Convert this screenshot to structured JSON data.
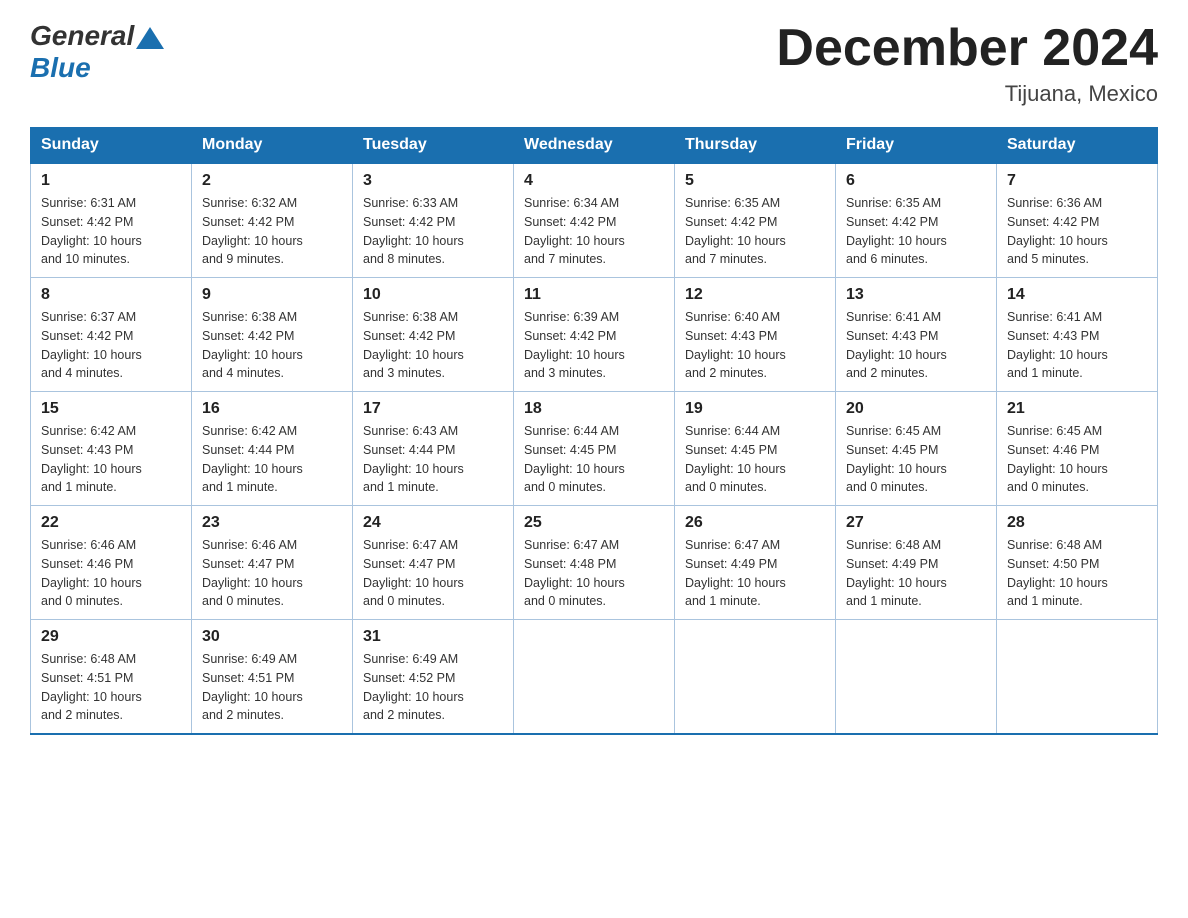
{
  "logo": {
    "general": "General",
    "blue": "Blue"
  },
  "title": "December 2024",
  "location": "Tijuana, Mexico",
  "days_header": [
    "Sunday",
    "Monday",
    "Tuesday",
    "Wednesday",
    "Thursday",
    "Friday",
    "Saturday"
  ],
  "weeks": [
    [
      {
        "day": "1",
        "sunrise": "6:31 AM",
        "sunset": "4:42 PM",
        "daylight": "10 hours and 10 minutes."
      },
      {
        "day": "2",
        "sunrise": "6:32 AM",
        "sunset": "4:42 PM",
        "daylight": "10 hours and 9 minutes."
      },
      {
        "day": "3",
        "sunrise": "6:33 AM",
        "sunset": "4:42 PM",
        "daylight": "10 hours and 8 minutes."
      },
      {
        "day": "4",
        "sunrise": "6:34 AM",
        "sunset": "4:42 PM",
        "daylight": "10 hours and 7 minutes."
      },
      {
        "day": "5",
        "sunrise": "6:35 AM",
        "sunset": "4:42 PM",
        "daylight": "10 hours and 7 minutes."
      },
      {
        "day": "6",
        "sunrise": "6:35 AM",
        "sunset": "4:42 PM",
        "daylight": "10 hours and 6 minutes."
      },
      {
        "day": "7",
        "sunrise": "6:36 AM",
        "sunset": "4:42 PM",
        "daylight": "10 hours and 5 minutes."
      }
    ],
    [
      {
        "day": "8",
        "sunrise": "6:37 AM",
        "sunset": "4:42 PM",
        "daylight": "10 hours and 4 minutes."
      },
      {
        "day": "9",
        "sunrise": "6:38 AM",
        "sunset": "4:42 PM",
        "daylight": "10 hours and 4 minutes."
      },
      {
        "day": "10",
        "sunrise": "6:38 AM",
        "sunset": "4:42 PM",
        "daylight": "10 hours and 3 minutes."
      },
      {
        "day": "11",
        "sunrise": "6:39 AM",
        "sunset": "4:42 PM",
        "daylight": "10 hours and 3 minutes."
      },
      {
        "day": "12",
        "sunrise": "6:40 AM",
        "sunset": "4:43 PM",
        "daylight": "10 hours and 2 minutes."
      },
      {
        "day": "13",
        "sunrise": "6:41 AM",
        "sunset": "4:43 PM",
        "daylight": "10 hours and 2 minutes."
      },
      {
        "day": "14",
        "sunrise": "6:41 AM",
        "sunset": "4:43 PM",
        "daylight": "10 hours and 1 minute."
      }
    ],
    [
      {
        "day": "15",
        "sunrise": "6:42 AM",
        "sunset": "4:43 PM",
        "daylight": "10 hours and 1 minute."
      },
      {
        "day": "16",
        "sunrise": "6:42 AM",
        "sunset": "4:44 PM",
        "daylight": "10 hours and 1 minute."
      },
      {
        "day": "17",
        "sunrise": "6:43 AM",
        "sunset": "4:44 PM",
        "daylight": "10 hours and 1 minute."
      },
      {
        "day": "18",
        "sunrise": "6:44 AM",
        "sunset": "4:45 PM",
        "daylight": "10 hours and 0 minutes."
      },
      {
        "day": "19",
        "sunrise": "6:44 AM",
        "sunset": "4:45 PM",
        "daylight": "10 hours and 0 minutes."
      },
      {
        "day": "20",
        "sunrise": "6:45 AM",
        "sunset": "4:45 PM",
        "daylight": "10 hours and 0 minutes."
      },
      {
        "day": "21",
        "sunrise": "6:45 AM",
        "sunset": "4:46 PM",
        "daylight": "10 hours and 0 minutes."
      }
    ],
    [
      {
        "day": "22",
        "sunrise": "6:46 AM",
        "sunset": "4:46 PM",
        "daylight": "10 hours and 0 minutes."
      },
      {
        "day": "23",
        "sunrise": "6:46 AM",
        "sunset": "4:47 PM",
        "daylight": "10 hours and 0 minutes."
      },
      {
        "day": "24",
        "sunrise": "6:47 AM",
        "sunset": "4:47 PM",
        "daylight": "10 hours and 0 minutes."
      },
      {
        "day": "25",
        "sunrise": "6:47 AM",
        "sunset": "4:48 PM",
        "daylight": "10 hours and 0 minutes."
      },
      {
        "day": "26",
        "sunrise": "6:47 AM",
        "sunset": "4:49 PM",
        "daylight": "10 hours and 1 minute."
      },
      {
        "day": "27",
        "sunrise": "6:48 AM",
        "sunset": "4:49 PM",
        "daylight": "10 hours and 1 minute."
      },
      {
        "day": "28",
        "sunrise": "6:48 AM",
        "sunset": "4:50 PM",
        "daylight": "10 hours and 1 minute."
      }
    ],
    [
      {
        "day": "29",
        "sunrise": "6:48 AM",
        "sunset": "4:51 PM",
        "daylight": "10 hours and 2 minutes."
      },
      {
        "day": "30",
        "sunrise": "6:49 AM",
        "sunset": "4:51 PM",
        "daylight": "10 hours and 2 minutes."
      },
      {
        "day": "31",
        "sunrise": "6:49 AM",
        "sunset": "4:52 PM",
        "daylight": "10 hours and 2 minutes."
      },
      null,
      null,
      null,
      null
    ]
  ],
  "labels": {
    "sunrise": "Sunrise:",
    "sunset": "Sunset:",
    "daylight": "Daylight:"
  }
}
